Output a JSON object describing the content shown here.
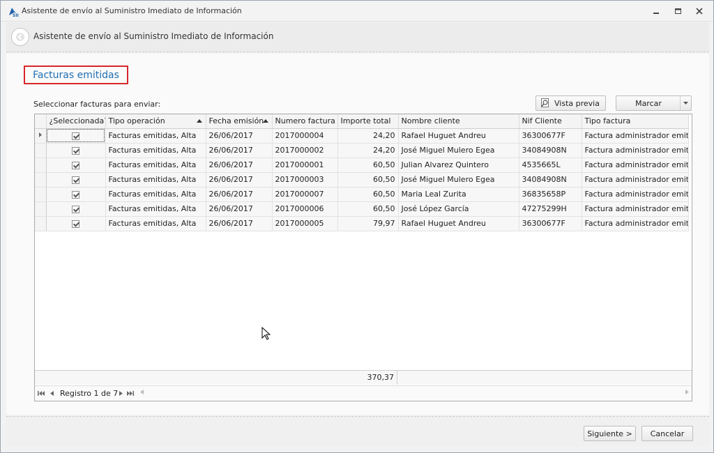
{
  "window": {
    "title": "Asistente de envío al Suministro Imediato de Información",
    "controls": [
      "minimize",
      "restore",
      "close"
    ]
  },
  "header": {
    "title": "Asistente de envío al Suministro Imediato de Información"
  },
  "section_title": "Facturas emitidas",
  "select_label": "Seleccionar facturas para enviar:",
  "toolbar": {
    "preview_label": "Vista previa",
    "mark_label": "Marcar"
  },
  "grid": {
    "columns": [
      "¿Seleccionada?",
      "Tipo operación",
      "Fecha emisión",
      "Numero factura",
      "Importe total",
      "Nombre cliente",
      "Nif Cliente",
      "Tipo factura"
    ],
    "sorted_columns": [
      "Tipo operación",
      "Fecha emisión"
    ],
    "rows": [
      {
        "selected": true,
        "tipo": "Facturas emitidas, Alta",
        "fecha": "26/06/2017",
        "numero": "2017000004",
        "importe": "24,20",
        "cliente": "Rafael Huguet Andreu",
        "nif": "36300677F",
        "tipo_factura": "Factura administrador emitida"
      },
      {
        "selected": true,
        "tipo": "Facturas emitidas, Alta",
        "fecha": "26/06/2017",
        "numero": "2017000002",
        "importe": "24,20",
        "cliente": "José Miguel Mulero Egea",
        "nif": "34084908N",
        "tipo_factura": "Factura administrador emitida"
      },
      {
        "selected": true,
        "tipo": "Facturas emitidas, Alta",
        "fecha": "26/06/2017",
        "numero": "2017000001",
        "importe": "60,50",
        "cliente": "Julian Alvarez Quintero",
        "nif": "4535665L",
        "tipo_factura": "Factura administrador emitida"
      },
      {
        "selected": true,
        "tipo": "Facturas emitidas, Alta",
        "fecha": "26/06/2017",
        "numero": "2017000003",
        "importe": "60,50",
        "cliente": "José Miguel Mulero Egea",
        "nif": "34084908N",
        "tipo_factura": "Factura administrador emitida"
      },
      {
        "selected": true,
        "tipo": "Facturas emitidas, Alta",
        "fecha": "26/06/2017",
        "numero": "2017000007",
        "importe": "60,50",
        "cliente": "Maria Leal Zurita",
        "nif": "36835658P",
        "tipo_factura": "Factura administrador emitida"
      },
      {
        "selected": true,
        "tipo": "Facturas emitidas, Alta",
        "fecha": "26/06/2017",
        "numero": "2017000006",
        "importe": "60,50",
        "cliente": "José López García",
        "nif": "47275299H",
        "tipo_factura": "Factura administrador emitida"
      },
      {
        "selected": true,
        "tipo": "Facturas emitidas, Alta",
        "fecha": "26/06/2017",
        "numero": "2017000005",
        "importe": "79,97",
        "cliente": "Rafael Huguet Andreu",
        "nif": "36300677F",
        "tipo_factura": "Factura administrador emitida"
      }
    ],
    "total": "370,37",
    "navigator_text": "Registro 1 de 7"
  },
  "footer": {
    "next_label": "Siguiente >",
    "cancel_label": "Cancelar"
  },
  "colors": {
    "section_title_text": "#1f6fb2",
    "section_title_border": "#d9262c"
  }
}
